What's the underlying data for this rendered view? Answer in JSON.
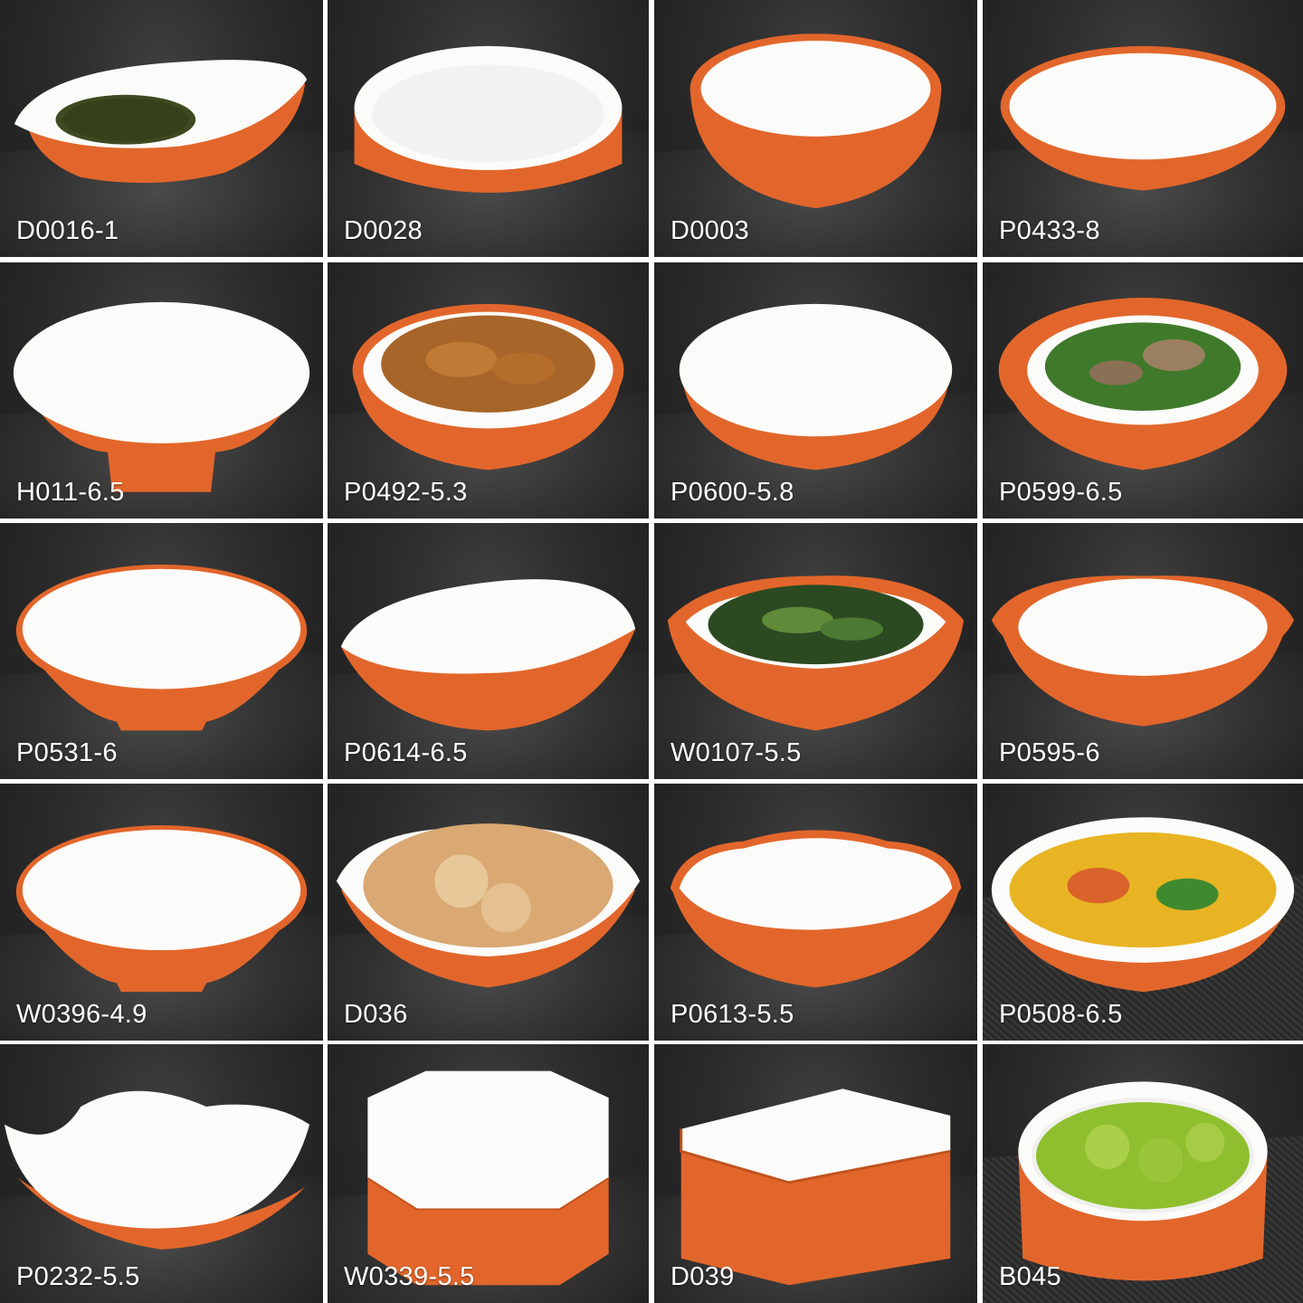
{
  "colors": {
    "orange": "#e2662b",
    "orange_dark": "#c2521d",
    "white": "#fbfbf9",
    "background": "#2a2a2a"
  },
  "products": [
    {
      "code": "D0016-1",
      "shape": "oval-tilted",
      "food": "seaweed-strips"
    },
    {
      "code": "D0028",
      "shape": "round-shallow",
      "food": ""
    },
    {
      "code": "D0003",
      "shape": "round-deep",
      "food": ""
    },
    {
      "code": "P0433-8",
      "shape": "wide-plate",
      "food": ""
    },
    {
      "code": "H011-6.5",
      "shape": "footed-bowl",
      "food": ""
    },
    {
      "code": "P0492-5.3",
      "shape": "round-bowl",
      "food": "fried-pork"
    },
    {
      "code": "P0600-5.8",
      "shape": "round-bowl",
      "food": ""
    },
    {
      "code": "P0599-6.5",
      "shape": "wide-rim-bowl",
      "food": "snow-peas-and-pork"
    },
    {
      "code": "P0531-6",
      "shape": "conical-bowl",
      "food": ""
    },
    {
      "code": "P0614-6.5",
      "shape": "slanted-bowl",
      "food": ""
    },
    {
      "code": "W0107-5.5",
      "shape": "square-bowl",
      "food": "cucumber-salad"
    },
    {
      "code": "P0595-6",
      "shape": "eared-bowl",
      "food": ""
    },
    {
      "code": "W0396-4.9",
      "shape": "conical-bowl",
      "food": ""
    },
    {
      "code": "D036",
      "shape": "square-bowl-white",
      "food": "lotus-root"
    },
    {
      "code": "P0613-5.5",
      "shape": "wavy-bowl",
      "food": ""
    },
    {
      "code": "P0508-6.5",
      "shape": "oval-bowl",
      "food": "corn-and-vegetables"
    },
    {
      "code": "P0232-5.5",
      "shape": "curled-square",
      "food": ""
    },
    {
      "code": "W0339-5.5",
      "shape": "hexagon",
      "food": ""
    },
    {
      "code": "D039",
      "shape": "square-box",
      "food": ""
    },
    {
      "code": "B045",
      "shape": "ramekin",
      "food": "green-grapes"
    }
  ]
}
